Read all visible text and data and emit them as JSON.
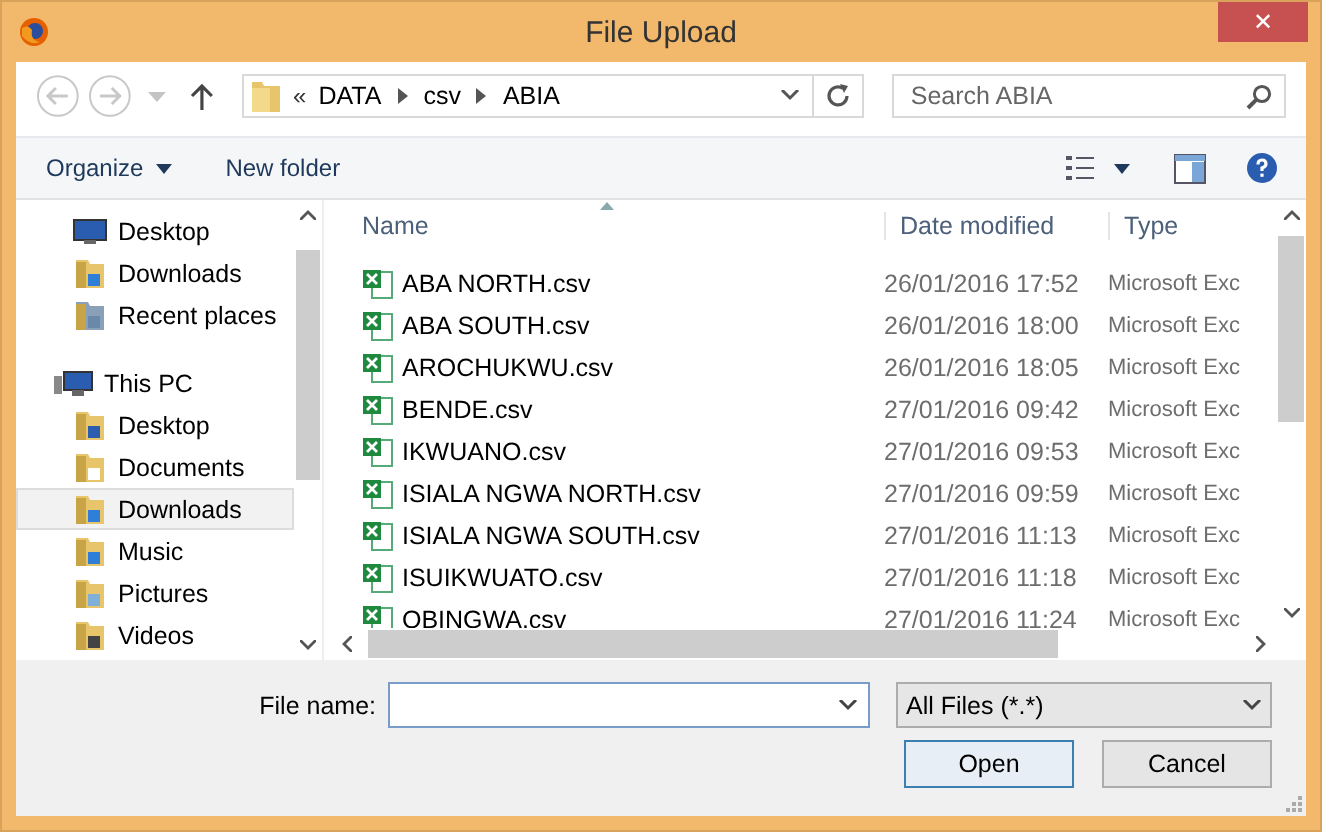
{
  "window": {
    "title": "File Upload",
    "close": "✕"
  },
  "nav": {
    "back_disabled": true,
    "forward_disabled": true,
    "breadcrumb_prefix": "«",
    "path": [
      "DATA",
      "csv",
      "ABIA"
    ],
    "search": {
      "placeholder": "Search ABIA"
    }
  },
  "toolbar": {
    "organize": "Organize",
    "new_folder": "New folder"
  },
  "sidebar": {
    "favorites": [
      {
        "label": "Desktop",
        "kind": "desktop",
        "selected": false
      },
      {
        "label": "Downloads",
        "kind": "downloads",
        "selected": false
      },
      {
        "label": "Recent places",
        "kind": "recent",
        "selected": false
      }
    ],
    "tree": [
      {
        "label": "This PC",
        "kind": "pc",
        "selected": false,
        "children": [
          {
            "label": "Desktop",
            "kind": "desktop-folder",
            "selected": false
          },
          {
            "label": "Documents",
            "kind": "documents",
            "selected": false
          },
          {
            "label": "Downloads",
            "kind": "downloads",
            "selected": true
          },
          {
            "label": "Music",
            "kind": "music",
            "selected": false
          },
          {
            "label": "Pictures",
            "kind": "pictures",
            "selected": false
          },
          {
            "label": "Videos",
            "kind": "videos",
            "selected": false
          }
        ]
      }
    ]
  },
  "table": {
    "columns": [
      "Name",
      "Date modified",
      "Type"
    ],
    "rows": [
      {
        "name": "ABA NORTH.csv",
        "date": "26/01/2016 17:52",
        "type": "Microsoft Exc"
      },
      {
        "name": "ABA SOUTH.csv",
        "date": "26/01/2016 18:00",
        "type": "Microsoft Exc"
      },
      {
        "name": "AROCHUKWU.csv",
        "date": "26/01/2016 18:05",
        "type": "Microsoft Exc"
      },
      {
        "name": "BENDE.csv",
        "date": "27/01/2016 09:42",
        "type": "Microsoft Exc"
      },
      {
        "name": "IKWUANO.csv",
        "date": "27/01/2016 09:53",
        "type": "Microsoft Exc"
      },
      {
        "name": "ISIALA NGWA NORTH.csv",
        "date": "27/01/2016 09:59",
        "type": "Microsoft Exc"
      },
      {
        "name": "ISIALA NGWA SOUTH.csv",
        "date": "27/01/2016 11:13",
        "type": "Microsoft Exc"
      },
      {
        "name": "ISUIKWUATO.csv",
        "date": "27/01/2016 11:18",
        "type": "Microsoft Exc"
      },
      {
        "name": "OBINGWA.csv",
        "date": "27/01/2016 11:24",
        "type": "Microsoft Exc"
      }
    ]
  },
  "footer": {
    "file_name_label": "File name:",
    "filter": "All Files (*.*)",
    "buttons": [
      {
        "label": "Open",
        "default": true
      },
      {
        "label": "Cancel",
        "default": false
      }
    ]
  }
}
